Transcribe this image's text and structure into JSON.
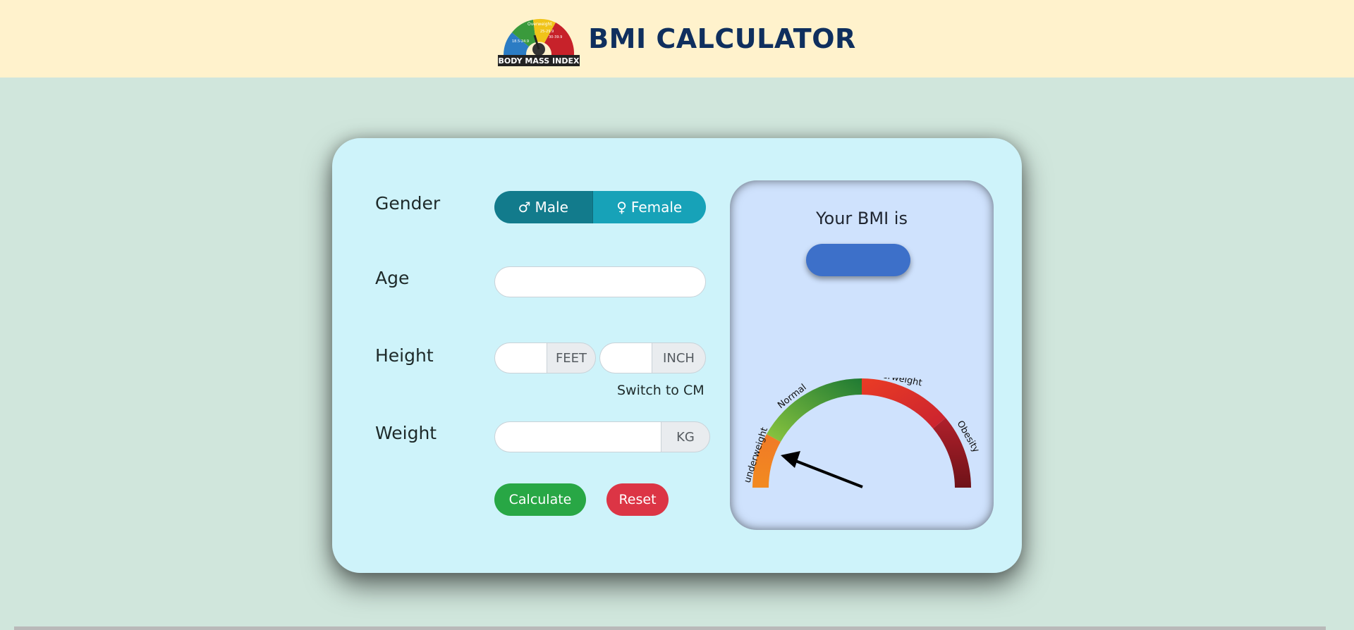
{
  "header": {
    "title": "BMI CALCULATOR",
    "logo_text": "BODY MASS INDEX",
    "logo_segments": [
      "Overweight",
      "25-29.9",
      "30-39.9",
      "18.5-24.9"
    ]
  },
  "form": {
    "gender_label": "Gender",
    "male_label": "Male",
    "female_label": "Female",
    "age_label": "Age",
    "age_value": "",
    "height_label": "Height",
    "feet_value": "",
    "feet_unit": "FEET",
    "inch_value": "",
    "inch_unit": "INCH",
    "switch_label": "Switch to CM",
    "weight_label": "Weight",
    "weight_value": "",
    "weight_unit": "KG",
    "calculate_label": "Calculate",
    "reset_label": "Reset"
  },
  "result": {
    "title": "Your BMI is",
    "value": ""
  },
  "gauge": {
    "categories": [
      "underweight",
      "Normal",
      "Overweight",
      "Obesity"
    ],
    "colors": {
      "underweight": "#f2841f",
      "normal": "#3f9a3c",
      "overweight": "#e23a2c",
      "obesity": "#7d1419"
    }
  },
  "colors": {
    "header_bg": "#fff2cc",
    "page_bg": "#d0e6dc",
    "card_bg": "#cef3fa",
    "male_active": "#127b8c",
    "female": "#17a2b8",
    "calculate": "#28a745",
    "reset": "#dc3545",
    "bmi_pill": "#3d70c9"
  },
  "icons": {
    "male": "male-symbol-icon",
    "female": "female-symbol-icon"
  }
}
